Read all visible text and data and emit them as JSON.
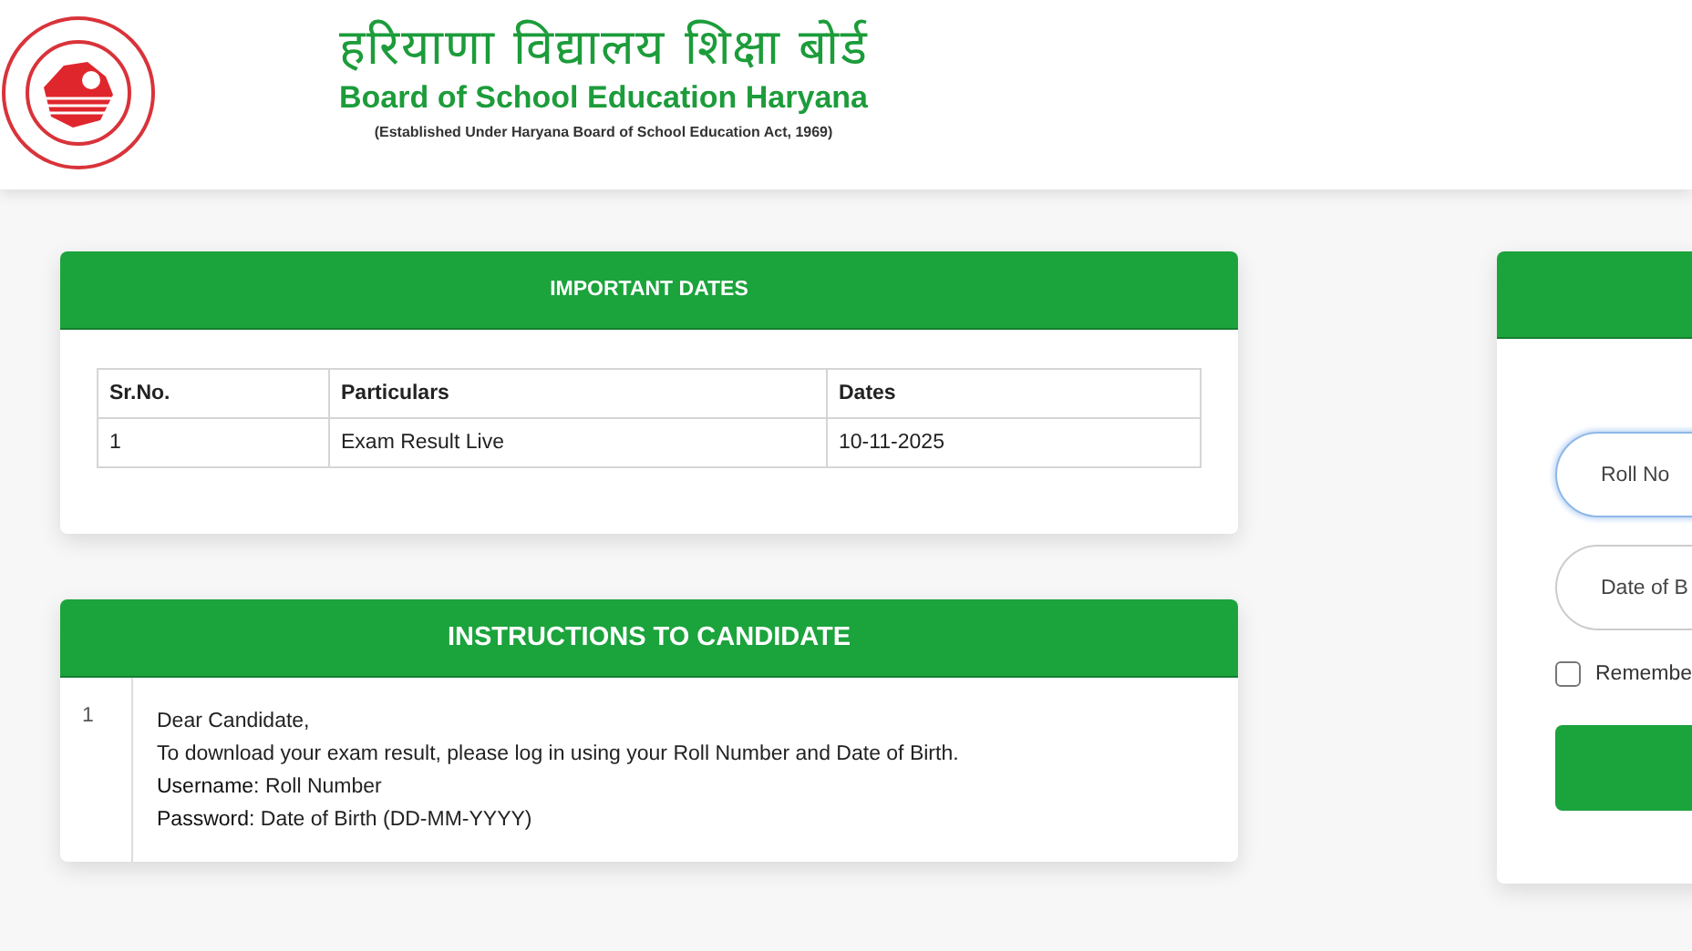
{
  "header": {
    "title_hindi": "हरियाणा विद्यालय शिक्षा बोर्ड",
    "title": "Board of School Education Haryana",
    "subtitle": "(Established Under Haryana Board of School Education Act, 1969)"
  },
  "important_dates": {
    "heading": "IMPORTANT DATES",
    "columns": [
      "Sr.No.",
      "Particulars",
      "Dates"
    ],
    "rows": [
      [
        "1",
        "Exam Result Live",
        "10-11-2025"
      ]
    ]
  },
  "instructions": {
    "heading": "INSTRUCTIONS TO CANDIDATE",
    "items": [
      {
        "number": "1",
        "lines": [
          "Dear Candidate,",
          "To download your exam result, please log in using your Roll Number and Date of Birth.",
          "**Username:** Roll Number",
          "**Password:** Date of Birth (DD-MM-YYYY)"
        ]
      }
    ]
  },
  "login": {
    "fields": [
      {
        "placeholder": "Roll No",
        "focused": true
      },
      {
        "placeholder": "Date of B",
        "focused": false
      }
    ],
    "remember": {
      "label": "Remembe",
      "checked": false
    }
  }
}
